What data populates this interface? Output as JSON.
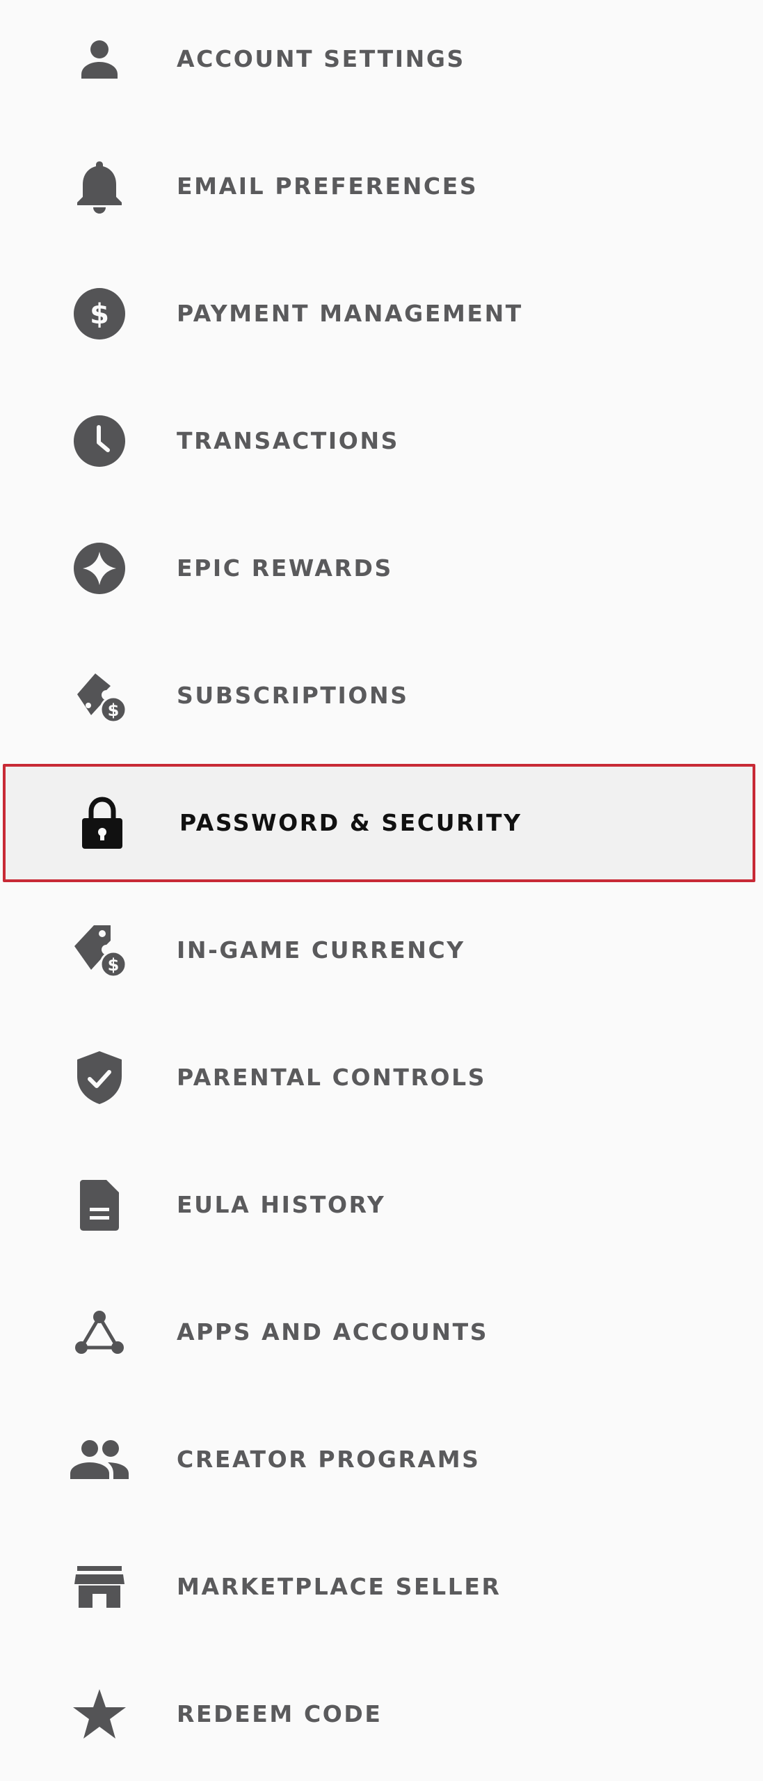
{
  "colors": {
    "background": "#fafafa",
    "text": "#5a5a5c",
    "icon": "#545456",
    "active_text": "#111111",
    "active_background": "#f1f1f1",
    "active_border": "#c82a36"
  },
  "sidebar": {
    "items": [
      {
        "label": "ACCOUNT SETTINGS",
        "icon": "person-icon",
        "active": false
      },
      {
        "label": "EMAIL PREFERENCES",
        "icon": "bell-icon",
        "active": false
      },
      {
        "label": "PAYMENT MANAGEMENT",
        "icon": "dollar-icon",
        "active": false
      },
      {
        "label": "TRANSACTIONS",
        "icon": "clock-icon",
        "active": false
      },
      {
        "label": "EPIC REWARDS",
        "icon": "sparkle-icon",
        "active": false
      },
      {
        "label": "SUBSCRIPTIONS",
        "icon": "ticket-dollar-icon",
        "active": false
      },
      {
        "label": "PASSWORD & SECURITY",
        "icon": "lock-icon",
        "active": true
      },
      {
        "label": "IN-GAME CURRENCY",
        "icon": "tag-dollar-icon",
        "active": false
      },
      {
        "label": "PARENTAL CONTROLS",
        "icon": "shield-check-icon",
        "active": false
      },
      {
        "label": "EULA HISTORY",
        "icon": "document-icon",
        "active": false
      },
      {
        "label": "APPS AND ACCOUNTS",
        "icon": "connection-icon",
        "active": false
      },
      {
        "label": "CREATOR PROGRAMS",
        "icon": "people-icon",
        "active": false
      },
      {
        "label": "MARKETPLACE SELLER",
        "icon": "storefront-icon",
        "active": false
      },
      {
        "label": "REDEEM CODE",
        "icon": "star-icon",
        "active": false
      }
    ]
  }
}
